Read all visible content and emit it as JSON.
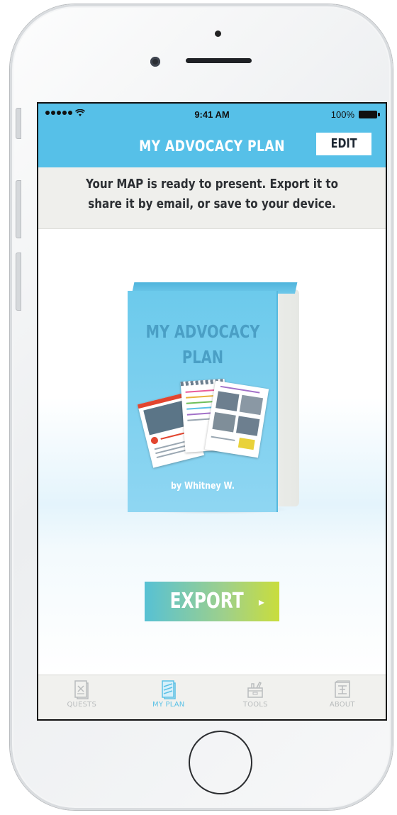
{
  "status_bar": {
    "time": "9:41 AM",
    "battery": "100%"
  },
  "nav": {
    "title": "MY ADVOCACY PLAN",
    "edit_label": "EDIT"
  },
  "banner": {
    "message": "Your MAP is ready to present. Export it to share it by email, or save to your device."
  },
  "book": {
    "title_line1": "MY ADVOCACY",
    "title_line2": "PLAN",
    "author": "by Whitney W."
  },
  "export_button": {
    "label": "EXPORT",
    "arrow": "▸"
  },
  "tabs": [
    {
      "label": "QUESTS",
      "icon": "quests-icon",
      "active": false
    },
    {
      "label": "MY PLAN",
      "icon": "my-plan-icon",
      "active": true
    },
    {
      "label": "TOOLS",
      "icon": "tools-icon",
      "active": false
    },
    {
      "label": "ABOUT",
      "icon": "about-icon",
      "active": false
    }
  ],
  "colors": {
    "nav_blue": "#56c0e8",
    "export_start": "#57c1d4",
    "export_end": "#c9dd3c",
    "tab_active": "#5bc1e6",
    "tab_inactive": "#b9bcbd"
  }
}
